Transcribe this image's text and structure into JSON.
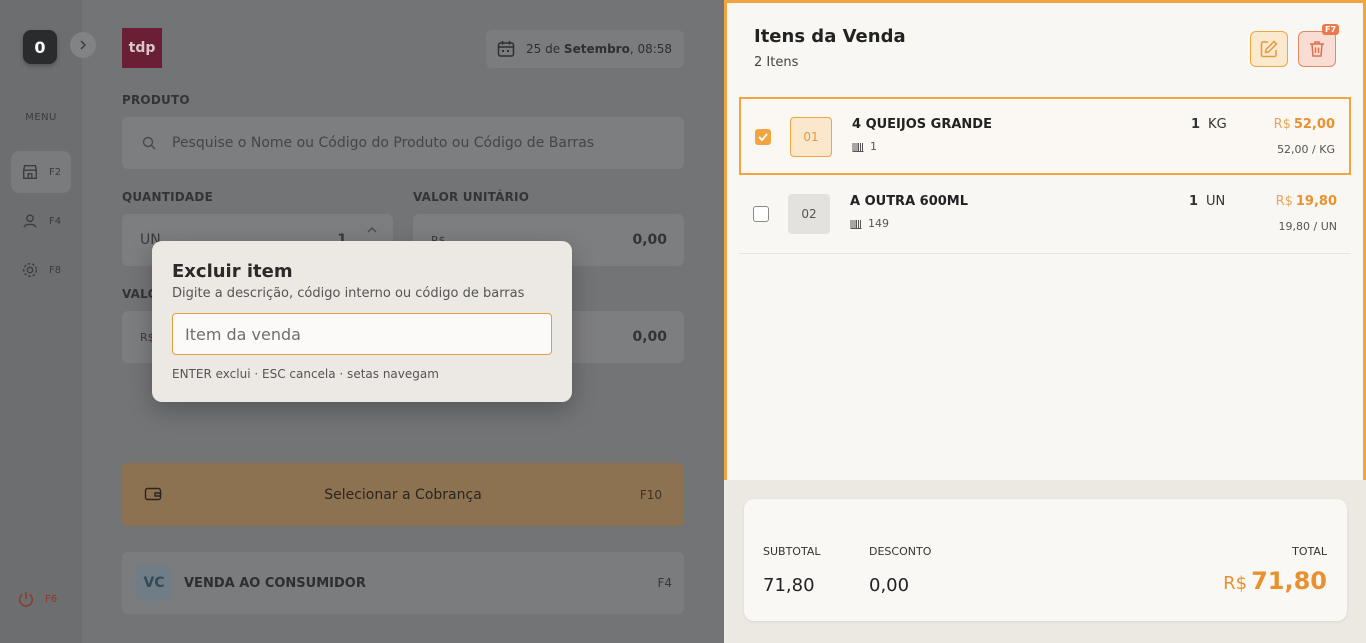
{
  "sidebar": {
    "count": "0",
    "menu_label": "MENU",
    "items": [
      {
        "icon": "store-icon",
        "key": "F2"
      },
      {
        "icon": "user-icon",
        "key": "F4"
      },
      {
        "icon": "gear-icon",
        "key": "F8"
      }
    ],
    "power_key": "F6"
  },
  "header": {
    "logo_text": "tdp",
    "date_day": "25 de",
    "date_month": "Setembro",
    "date_time": ", 08:58"
  },
  "form": {
    "produto_label": "PRODUTO",
    "search_placeholder": "Pesquise o Nome ou Código do Produto ou Código de Barras",
    "quantidade_label": "QUANTIDADE",
    "quantidade_unit": "UN",
    "quantidade_value": "1",
    "valor_unitario_label": "VALOR UNITÁRIO",
    "valor_unitario_prefix": "R$",
    "valor_unitario_value": "0,00",
    "valor_total_label": "VALO",
    "valor_total_prefix": "R$",
    "valor_total_value": "0,00"
  },
  "payment": {
    "label": "Selecionar a Cobrança",
    "key": "F10"
  },
  "customer": {
    "initials": "VC",
    "name": "VENDA AO CONSUMIDOR",
    "key": "F4"
  },
  "modal": {
    "title": "Excluir item",
    "subtitle": "Digite a descrição, código interno ou código de barras",
    "input_placeholder": "Item da venda",
    "hint": "ENTER exclui · ESC cancela · setas navegam"
  },
  "items": {
    "title": "Itens da Venda",
    "count": "2 Itens",
    "delete_key": "F7",
    "list": [
      {
        "code": "01",
        "name": "4 QUEIJOS GRANDE",
        "barcode": "1",
        "qty": "1",
        "unit": "KG",
        "currency": "R$",
        "price": "52,00",
        "unit_price": "52,00 / KG",
        "selected": true
      },
      {
        "code": "02",
        "name": "A OUTRA 600ML",
        "barcode": "149",
        "qty": "1",
        "unit": "UN",
        "currency": "R$",
        "price": "19,80",
        "unit_price": "19,80 / UN",
        "selected": false
      }
    ]
  },
  "totals": {
    "subtotal_label": "SUBTOTAL",
    "subtotal": "71,80",
    "desconto_label": "DESCONTO",
    "desconto": "0,00",
    "total_label": "TOTAL",
    "currency": "R$",
    "total": "71,80"
  },
  "colors": {
    "accent": "#f0a541",
    "price": "#e8912e"
  }
}
